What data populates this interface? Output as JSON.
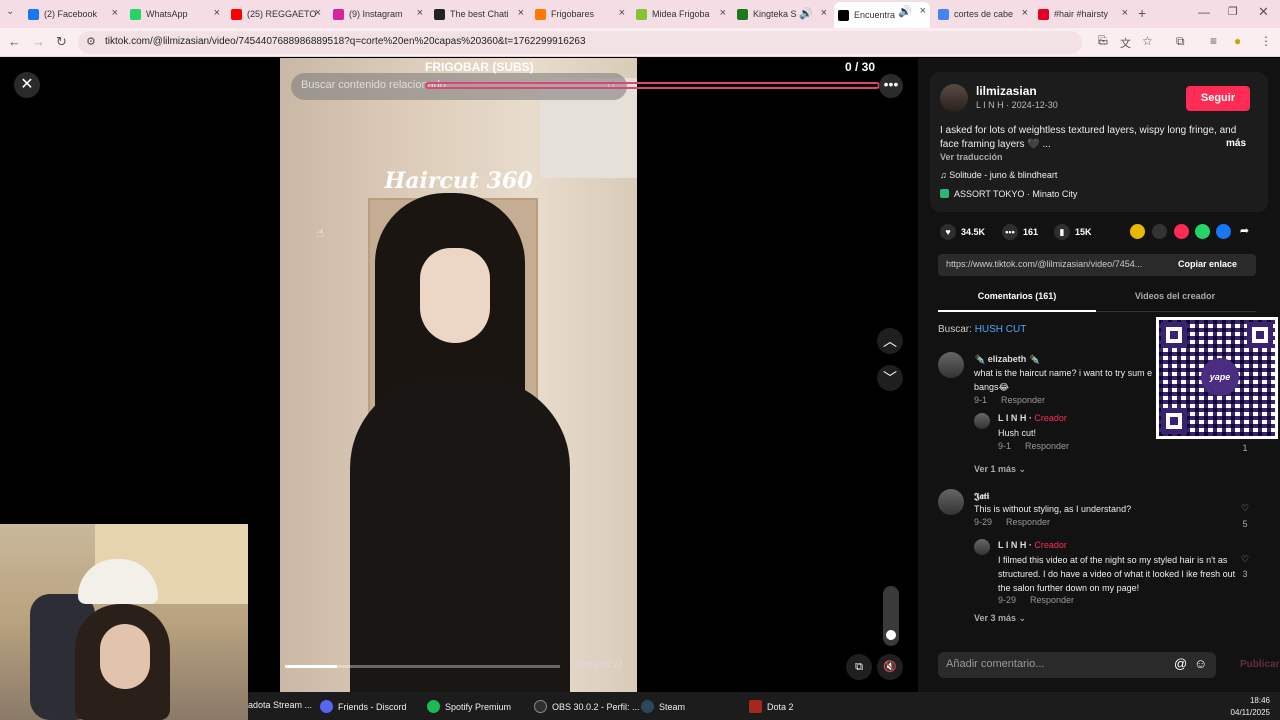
{
  "browser": {
    "tabs": [
      {
        "label": "(2) Facebook",
        "color": "#1877f2"
      },
      {
        "label": "WhatsApp",
        "color": "#25d366"
      },
      {
        "label": "(25) REGGAETO",
        "color": "#ff0000"
      },
      {
        "label": "(9) Instagram",
        "color": "#d6249f"
      },
      {
        "label": "The best Chati",
        "color": "#222222"
      },
      {
        "label": "Frigobares",
        "color": "#ff7a00"
      },
      {
        "label": "Midea Frigoba",
        "color": "#86c232"
      },
      {
        "label": "Kingteka S",
        "color": "#1b7a1b"
      },
      {
        "label": "Encuentra",
        "color": "#000000"
      },
      {
        "label": "cortes de cabe",
        "color": "#4285f4"
      },
      {
        "label": "#hair #hairsty",
        "color": "#e60023"
      }
    ],
    "url": "tiktok.com/@lilmizasian/video/7454407688986889518?q=corte%20en%20capas%20360&t=1762299916263"
  },
  "video": {
    "stream_title": "FRIGOBAR (SUBS)",
    "counter": "0  / 30",
    "search_placeholder": "Buscar contenido relacionado",
    "overlay_text": "Haircut 360",
    "timecode": "00:04/00:27",
    "progress": 0.19
  },
  "post": {
    "username": "lilmizasian",
    "subline": "L I N H · 2024-12-30",
    "follow_label": "Seguir",
    "description": "I asked for lots of weightless textured layers, wispy long fringe, and face framing layers 🖤 ...",
    "more_label": "más",
    "translate_label": "Ver traducción",
    "music": "♫  Solitude - juno & blindheart",
    "location": "ASSORT TOKYO · Minato City",
    "likes": "34.5K",
    "comments": "161",
    "saves": "15K",
    "link": "https://www.tiktok.com/@lilmizasian/video/7454...",
    "copy_label": "Copiar enlace",
    "tab_comments": "Comentarios (161)",
    "tab_videos": "Videos del creador",
    "search_prefix": "Buscar: ",
    "search_term": "HUSH CUT"
  },
  "comments": [
    {
      "name": "✒️ elizabeth ✒️",
      "text": "what is the haircut name? i want to try sum e bangs😂",
      "date": "9-1",
      "reply": "Responder",
      "likes": "1"
    },
    {
      "name": "L I N H · ",
      "tag": "Creador",
      "text": "Hush cut!",
      "date": "9-1",
      "reply": "Responder"
    },
    {
      "vermas": "Ver 1 más ⌄"
    },
    {
      "name": "𝕵𝖆𝖙𝖎",
      "text": "This is without styling, as I understand?",
      "date": "9-29",
      "reply": "Responder",
      "likes": "5"
    },
    {
      "name": "L I N H · ",
      "tag": "Creador",
      "text": "I filmed this video at of the night so my styled hair is n't as structured. I do have a video of what it looked l ike fresh out the salon further down on my page!",
      "date": "9-29",
      "reply": "Responder",
      "likes": "3"
    },
    {
      "vermas": "Ver 3 más ⌄"
    }
  ],
  "add_comment_placeholder": "Añadir comentario...",
  "publish_label": "Publicar",
  "qr_label": "yape",
  "taskbar": {
    "items": [
      {
        "label": "adota Stream ...",
        "color": "#444444"
      },
      {
        "label": "Friends - Discord",
        "color": "#5865f2"
      },
      {
        "label": "Spotify Premium",
        "color": "#1db954"
      },
      {
        "label": "OBS 30.0.2 - Perfil: ...",
        "color": "#302e31"
      },
      {
        "label": "Steam",
        "color": "#1b2838"
      },
      {
        "label": "Dota 2",
        "color": "#a4261c"
      }
    ],
    "time": "18:46",
    "date": "04/11/2025"
  }
}
